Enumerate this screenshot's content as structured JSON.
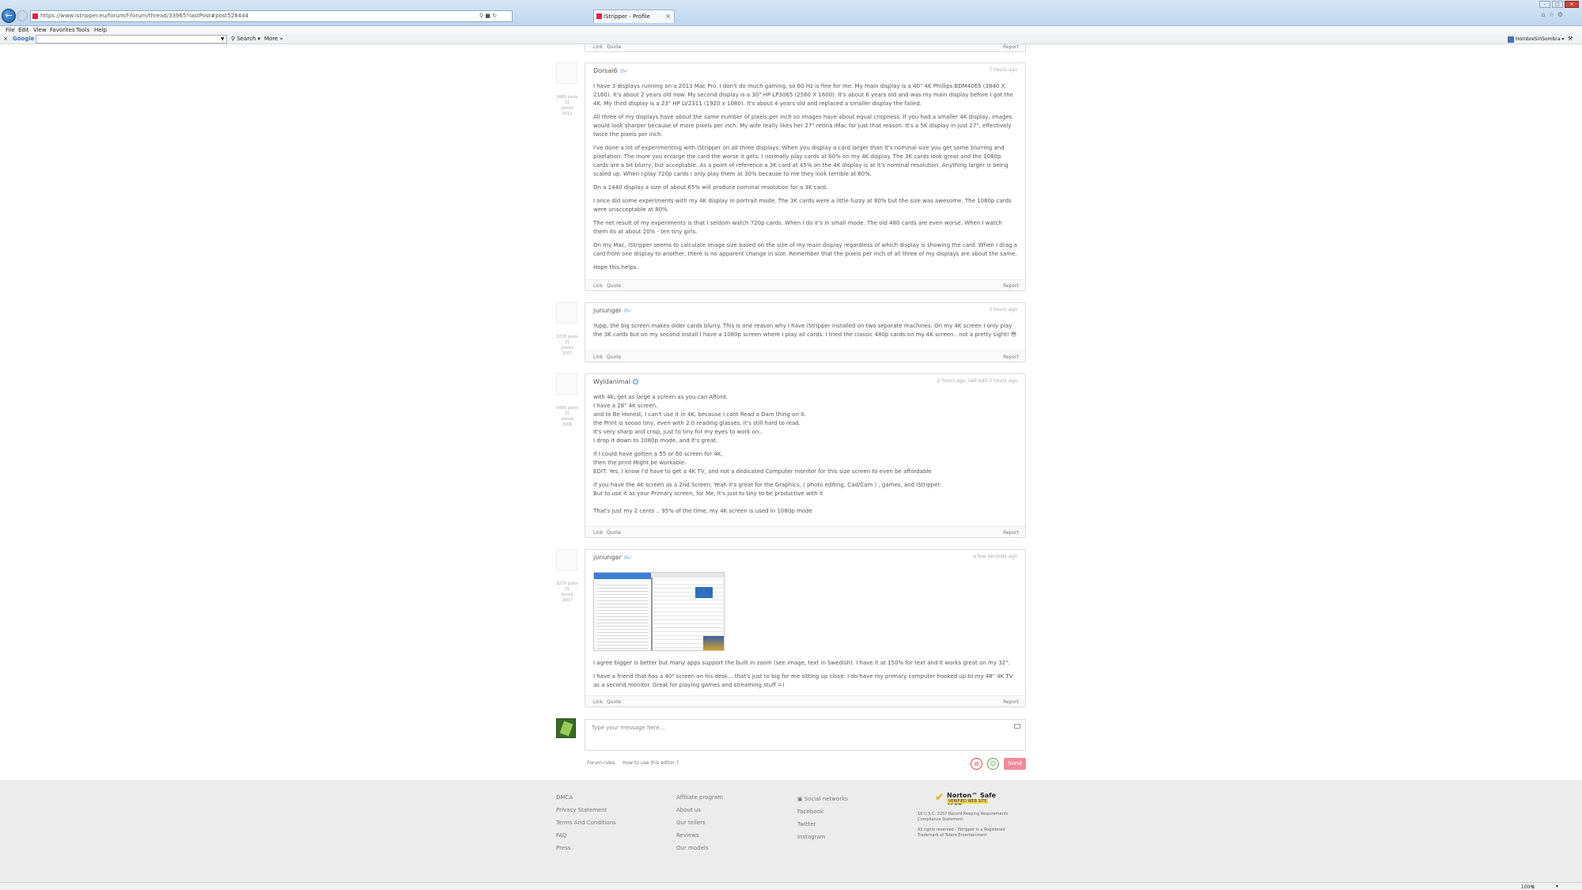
{
  "browser": {
    "url": "https://www.istripper.eu/forum/f-forum/thread/33965?lastPost#post528444",
    "tab_title": "iStripper - Profile",
    "menu": [
      "File",
      "Edit",
      "View",
      "Favorites",
      "Tools",
      "Help"
    ],
    "toolbar": {
      "google_label": "Google",
      "search_label": "Search",
      "more_label": "More »",
      "user_label": "HombreSinSombra"
    },
    "zoom": "100%"
  },
  "posts": [
    {
      "user": "",
      "footer": {
        "link": "Link",
        "quote": "Quote",
        "report": "Report"
      }
    },
    {
      "user": "Dorsai6",
      "time": "7 hours ago",
      "stats": [
        "2489 posts",
        "31",
        "joined",
        "2012"
      ],
      "paragraphs": [
        "I have 3 displays running on a 2013 Mac Pro. I don't do much gaming, so 60 Hz is fine for me. My main display is a 40\" 4K Phillips BDM4065 (3840 X 2160). It's about 2 years old now. My second display is a 30\" HP LP3065 (2560 X 1600). It's about 6 years old and was my main display before I got the 4K. My third display is a 23\" HP LV2311 (1920 x 1080). It's about 4 years old and replaced a smaller display the failed.",
        "All three of my displays have about the same number of pixels per inch so images have about equal crispness. If you had a smaller 4K display, images would look sharper because of more pixels per inch. My wife really likes her 27\" retina iMac for just that reason. It's a 5K display in just 27\", effectively twice the pixels per inch.",
        "I've done a lot of experimenting with iStripper on all three displays. When you display a card larger than it's nominal size you get some blurring and pixelation. The more you enlarge the card the worse it gets. I normally play cards at 60% on my 4K display. The 3K cards look great and the 1080p cards are a bit blurry, but acceptable. As a point of reference a 3K card at 45% on the 4K display is at it's nominal resolution. Anything larger is being scaled up. When I play 720p cards I only play them at 30% because to me they look terrible at 60%.",
        "On a 1440 display a size of about 65% will produce nominal resolution for a 3K card.",
        "I once did some experiments with my 4K display in portrait mode. The 3K cards were a little fuzzy at 80% but the size was awesome. The 1080p cards were unacceptable at 80%.",
        "The net result of my experiments is that I seldom watch 720p cards. When I do it's in small mode. The old 480 cards are even worse. When I watch them its at about 20% - ten tiny girls.",
        "On my Mac, iStripper seems to calculate image size based on the size of my main display regardless of which display is showing the card. When I drag a card from one display to another, there is no apparent change in size. Remember that the pixels per inch of all three of my displays are about the same.",
        "Hope this helps."
      ],
      "footer": {
        "link": "Link",
        "quote": "Quote",
        "report": "Report"
      }
    },
    {
      "user": "jununger",
      "time": "3 hours ago",
      "stats": [
        "3218 posts",
        "31",
        "joined",
        "2007"
      ],
      "paragraphs": [
        "Yupp, the big screen makes older cards blurry. This is one reason why I have iStripper installed on two separate machines. On my 4K screen I only play the 3K cards but on my second install I have a 1080p screen where I play all cards. I tried the classic 480p cards on my 4K screen.. not a pretty sight! 😳"
      ],
      "footer": {
        "link": "Link",
        "quote": "Quote",
        "report": "Report"
      }
    },
    {
      "user": "Wyldanimal",
      "time": "2 hours ago, last edit 2 hours ago",
      "stats": [
        "5495 posts",
        "31",
        "joined",
        "2006"
      ],
      "blocks": [
        [
          "with 4K, get as large a screen as you can Afford.",
          "I have a 28\" 4K screen.",
          "and to Be Honest, I can't use it in 4K, because I cant Read a Dam thing on it.",
          "the Print is soooo tiny, even with 2.0 reading glasses, it's still hard to read.",
          "It's very sharp and crisp, just to tiny for my eyes to work on..",
          "I drop it down to 1080p mode, and It's great."
        ],
        [
          "If I could have gotten a 55 or 60 screen for 4K,",
          "then the print Might be workable.",
          "EDIT: Yes, I know I'd have to get a 4K TV, and not a dedicated Computer monitor for this size screen to even be affordable"
        ],
        [
          "If you have the 4K screen as a 2nd Screen, Yeah it's great for the Graphics, ( photo editing, Cad/Cam ) , games, and iStripper.",
          "But to use it as your Primary screen, for Me, It's just to tiny to be productive with it"
        ],
        [
          "That's just my 2 cents .. 95% of the time, my 4K screen is used in 1080p mode"
        ]
      ],
      "footer": {
        "link": "Link",
        "quote": "Quote",
        "report": "Report"
      }
    },
    {
      "user": "jununger",
      "time": "a few seconds ago",
      "stats": [
        "3219 posts",
        "31",
        "joined",
        "2007"
      ],
      "paragraphs": [
        "I agree bigger is better but many apps support the built in zoom (see image, text in Swedish). I have it at 150% for text and it works great on my 32\".",
        "I have a friend that has a 40\" screen on his desk... that's just to big for me sitting up close. I do have my primary computer hooked up to my 48\" 4K TV as a second monitor. Great for playing games and streaming stuff =)"
      ],
      "footer": {
        "link": "Link",
        "quote": "Quote",
        "report": "Report"
      }
    }
  ],
  "reply": {
    "placeholder": "Type your message here...",
    "forum_rules": "Forum rules",
    "how_to": "How to use this editor ?",
    "send": "Send"
  },
  "footer": {
    "col1": [
      "DMCA",
      "Privacy Statement",
      "Terms And Conditions",
      "FAQ",
      "Press"
    ],
    "col2": [
      "Affiliate program",
      "About us",
      "Our tellers",
      "Reviews",
      "Our models"
    ],
    "col3_title": "Social networks",
    "col3": [
      "Facebook",
      "Twitter",
      "Instagram"
    ],
    "norton_title": "Norton™ Safe Web",
    "norton_sub": "VERIFIED WEB SITE",
    "legal1": "18 U.S.C. 2257 Record-Keeping Requirements Compliance Statement",
    "legal2": "All rights reserved - iStripper is a Registered Trademark of Totem Entertainment"
  }
}
